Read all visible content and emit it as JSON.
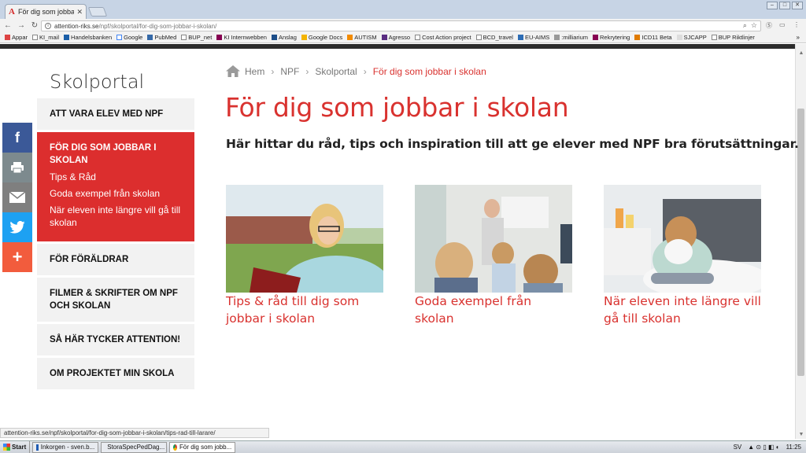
{
  "browser": {
    "tab_title": "För dig som jobbar i",
    "url_host": "attention-riks.se",
    "url_path": "/npf/skolportal/for-dig-som-jobbar-i-skolan/",
    "bookmarks": [
      "Appar",
      "KI_mail",
      "Handelsbanken",
      "Google",
      "PubMed",
      "BUP_net",
      "KI Internwebben",
      "Anslag",
      "Google Docs",
      "AUTISM",
      "Agresso",
      "Cost Action project",
      "BCD_travel",
      "EU-AIMS",
      ":milliarium",
      "Rekrytering",
      "ICD11 Beta",
      "SJCAPP",
      "BUP Riktlinjer"
    ],
    "bookmarks_more": "»",
    "status_url": "attention-riks.se/npf/skolportal/for-dig-som-jobbar-i-skolan/tips-rad-till-larare/"
  },
  "sidebar": {
    "heading": "Skolportal",
    "items": [
      {
        "label": "ATT VARA ELEV MED NPF"
      },
      {
        "label": "FÖR DIG SOM JOBBAR I SKOLAN",
        "subitems": [
          "Tips & Råd",
          "Goda exempel från skolan",
          "När eleven inte längre vill gå till skolan"
        ]
      },
      {
        "label": "FÖR FÖRÄLDRAR"
      },
      {
        "label": "FILMER & SKRIFTER OM NPF OCH SKOLAN"
      },
      {
        "label": "SÅ HÄR TYCKER ATTENTION!"
      },
      {
        "label": "OM PROJEKTET MIN SKOLA"
      }
    ]
  },
  "share": {
    "facebook": "f",
    "plus": "+"
  },
  "breadcrumb": {
    "items": [
      "Hem",
      "NPF",
      "Skolportal",
      "För dig som jobbar i skolan"
    ]
  },
  "main": {
    "title": "För dig som jobbar i skolan",
    "lead": "Här hittar du råd, tips och inspiration till att ge elever med NPF bra förutsättningar.",
    "cards": [
      {
        "caption": "Tips & råd till dig som jobbar i skolan"
      },
      {
        "caption": "Goda exempel från skolan"
      },
      {
        "caption": "När eleven inte längre vill gå till skolan"
      }
    ]
  },
  "taskbar": {
    "start": "Start",
    "items": [
      "Inkorgen - sven.b...",
      "StoraSpecPedDag...",
      "För dig som jobb..."
    ],
    "lang": "SV",
    "clock": "11:25"
  },
  "colors": {
    "accent_red": "#d9322f",
    "nav_active": "#dc2e2e",
    "facebook": "#3b5998",
    "twitter": "#1da1f2"
  }
}
